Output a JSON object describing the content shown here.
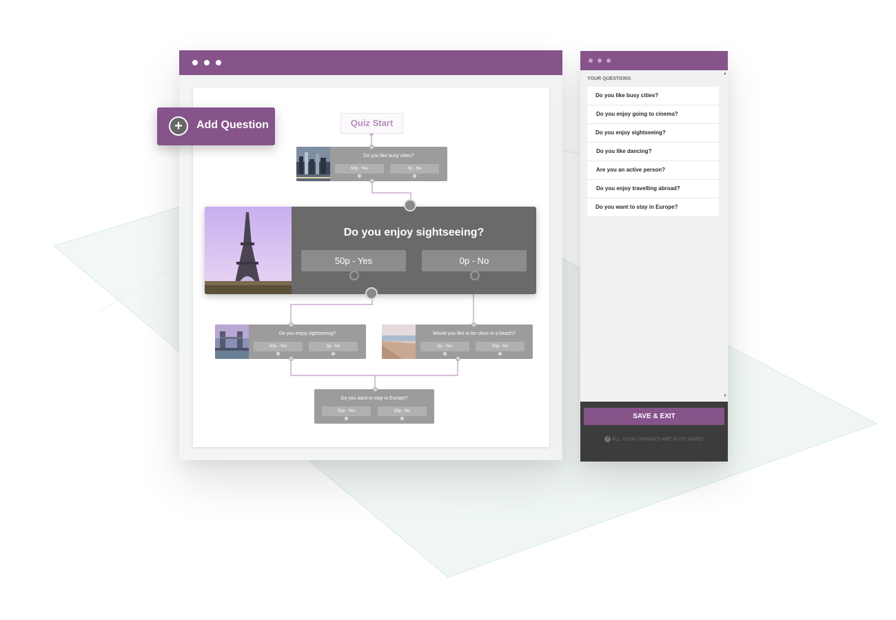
{
  "add_question": {
    "label": "Add Question",
    "icon": "plus-circle-icon"
  },
  "flow": {
    "start_label": "Quiz Start",
    "cards": {
      "top": {
        "question": "Do you like busy cities?",
        "answers": [
          "50p - Yes",
          "0p - No"
        ],
        "image": "city-skyline-night"
      },
      "featured": {
        "question": "Do you enjoy sightseeing?",
        "answers": [
          "50p - Yes",
          "0p - No"
        ],
        "image": "eiffel-tower"
      },
      "left": {
        "question": "Do you enjoy sightseeing?",
        "answers": [
          "50p - Yes",
          "0p - No"
        ],
        "image": "tower-bridge"
      },
      "right": {
        "question": "Would you like to be close to a beach?",
        "answers": [
          "0p - Yes",
          "50p - No"
        ],
        "image": "beach"
      },
      "bottom": {
        "question": "Do you want to stay in Europe?",
        "answers": [
          "50p - Yes",
          "50p - No"
        ]
      }
    }
  },
  "sidebar": {
    "heading": "YOUR QUESTIONS",
    "questions": [
      "Do you like busy cities?",
      "Do you enjoy going to cinema?",
      "Do you enjoy sightseeing?",
      "Do you like dancing?",
      "Are you an active person?",
      "Do you enjoy travelling abroad?",
      "Do you want to stay in Europe?"
    ],
    "save_label": "SAVE & EXIT",
    "autosave_note": "ALL YOUR CHANGES ARE AUTO SAVED"
  },
  "colors": {
    "brand": "#86538b",
    "brand_light": "#b68dba",
    "card": "#9c9c9c",
    "featured_card": "#6a6a6a",
    "footer": "#3c3c3c"
  }
}
